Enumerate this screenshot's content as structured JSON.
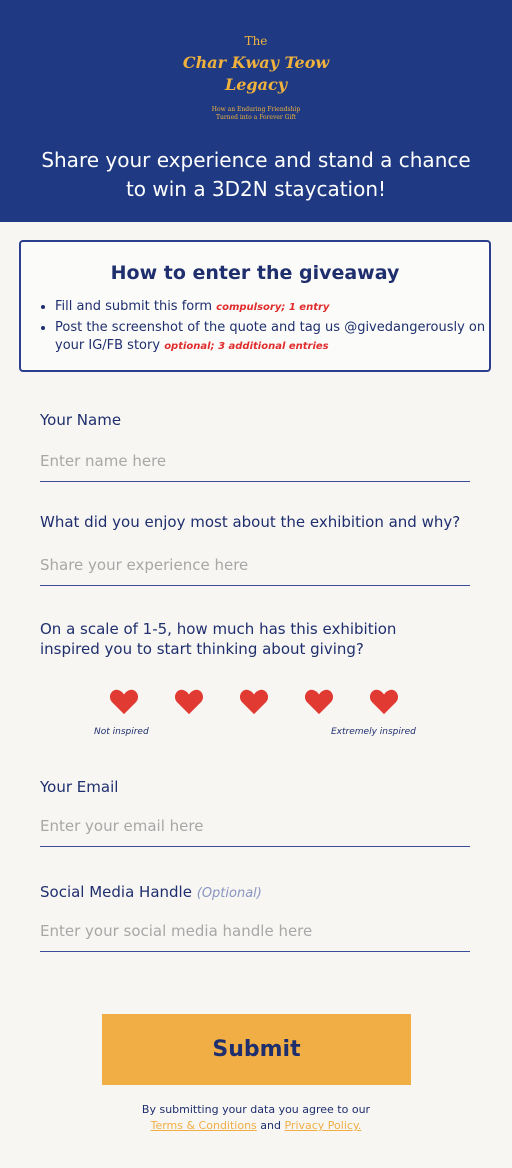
{
  "header": {
    "logo_the": "The",
    "logo_title_line1": "Char Kway Teow",
    "logo_title_line2": "Legacy",
    "logo_subtitle_line1": "How an Enduring Friendship",
    "logo_subtitle_line2": "Turned into a Forever Gift",
    "headline": "Share your experience and stand a chance to win a 3D2N staycation!"
  },
  "giveaway": {
    "title": "How to enter the giveaway",
    "items": [
      {
        "text": "Fill and submit this form",
        "tag": "compulsory; 1 entry"
      },
      {
        "text": "Post the screenshot of the quote and tag us @givedangerously on your IG/FB story",
        "tag": "optional; 3 additional entries"
      }
    ]
  },
  "form": {
    "name_label": "Your Name",
    "name_placeholder": "Enter name here",
    "experience_label": "What did you enjoy most about the exhibition and why?",
    "experience_placeholder": "Share your experience here",
    "scale_label": "On a scale of 1-5, how much has this exhibition inspired you to start thinking about giving?",
    "scale_min_label": "Not inspired",
    "scale_max_label": "Extremely inspired",
    "email_label": "Your Email",
    "email_placeholder": "Enter your email here",
    "social_label": "Social Media Handle",
    "social_optional": "(Optional)",
    "social_placeholder": "Enter your social media handle here",
    "submit_label": "Submit"
  },
  "consent": {
    "text": "By submitting your data you agree to our",
    "terms_link": "Terms & Conditions",
    "and": "and",
    "privacy_link": "Privacy Policy."
  },
  "colors": {
    "header_bg": "#1f3a82",
    "accent": "#f0ae44",
    "heart": "#e03a32",
    "text": "#1f2f6e"
  }
}
